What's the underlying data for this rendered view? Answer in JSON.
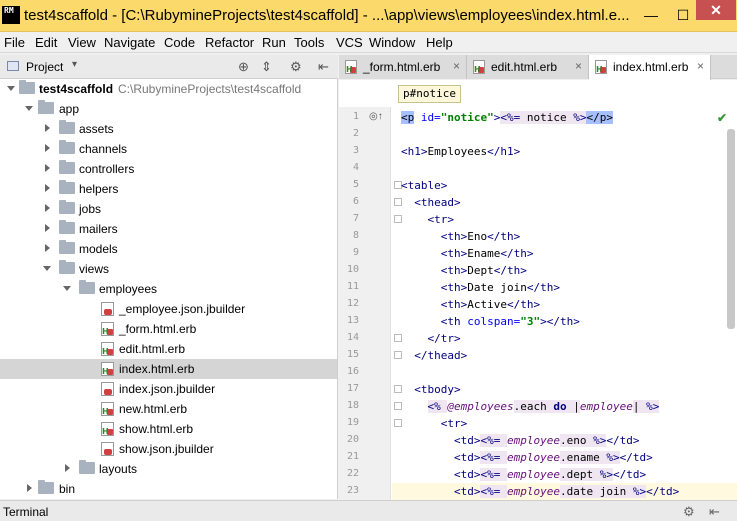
{
  "window": {
    "title": "test4scaffold - [C:\\RubymineProjects\\test4scaffold] - ...\\app\\views\\employees\\index.html.e...",
    "app_icon": "RM",
    "minimize": "—",
    "maximize": "☐",
    "close": "✕"
  },
  "menu": [
    "File",
    "Edit",
    "View",
    "Navigate",
    "Code",
    "Refactor",
    "Run",
    "Tools",
    "VCS",
    "Window",
    "Help"
  ],
  "project_pane": {
    "label": "Project",
    "dropdown": "▾",
    "icons": [
      "globe-icon",
      "collapse-icon",
      "gear-icon",
      "hide-icon"
    ]
  },
  "tree": [
    {
      "label": "test4scaffold",
      "path": "C:\\RubymineProjects\\test4scaffold",
      "type": "folder",
      "level": 0,
      "expanded": true,
      "bold": true
    },
    {
      "label": "app",
      "type": "folder",
      "level": 1,
      "expanded": true
    },
    {
      "label": "assets",
      "type": "folder",
      "level": 2,
      "expanded": false
    },
    {
      "label": "channels",
      "type": "folder",
      "level": 2,
      "expanded": false
    },
    {
      "label": "controllers",
      "type": "folder",
      "level": 2,
      "expanded": false
    },
    {
      "label": "helpers",
      "type": "folder",
      "level": 2,
      "expanded": false
    },
    {
      "label": "jobs",
      "type": "folder",
      "level": 2,
      "expanded": false
    },
    {
      "label": "mailers",
      "type": "folder",
      "level": 2,
      "expanded": false
    },
    {
      "label": "models",
      "type": "folder",
      "level": 2,
      "expanded": false
    },
    {
      "label": "views",
      "type": "folder",
      "level": 2,
      "expanded": true
    },
    {
      "label": "employees",
      "type": "folder",
      "level": 3,
      "expanded": true
    },
    {
      "label": "_employee.json.jbuilder",
      "type": "jb",
      "level": 4
    },
    {
      "label": "_form.html.erb",
      "type": "erb",
      "level": 4
    },
    {
      "label": "edit.html.erb",
      "type": "erb",
      "level": 4
    },
    {
      "label": "index.html.erb",
      "type": "erb",
      "level": 4,
      "selected": true
    },
    {
      "label": "index.json.jbuilder",
      "type": "jb",
      "level": 4
    },
    {
      "label": "new.html.erb",
      "type": "erb",
      "level": 4
    },
    {
      "label": "show.html.erb",
      "type": "erb",
      "level": 4
    },
    {
      "label": "show.json.jbuilder",
      "type": "jb",
      "level": 4
    },
    {
      "label": "layouts",
      "type": "folder",
      "level": 3,
      "expanded": false
    },
    {
      "label": "bin",
      "type": "folder",
      "level": 1,
      "expanded": false
    }
  ],
  "tabs": [
    {
      "label": "_form.html.erb",
      "active": false
    },
    {
      "label": "edit.html.erb",
      "active": false
    },
    {
      "label": "index.html.erb",
      "active": true
    }
  ],
  "tab_close": "×",
  "breadcrumb": "p#notice",
  "editor": {
    "check_mark": "✔",
    "gutter_marker": "◎↑",
    "lines": [
      {
        "n": 1,
        "html": "<span class='sel'>&lt;p</span> <span class='attr'>id=</span><span class='str'>\"notice\"</span><span class='tag'>&gt;</span><span class='erbtag'>&lt;%=</span><span class='ruby'> notice </span><span class='erbtag'>%&gt;</span><span class='sel'>&lt;/p&gt;</span>"
      },
      {
        "n": 2,
        "html": ""
      },
      {
        "n": 3,
        "html": "<span class='tag'>&lt;h1&gt;</span>Employees<span class='tag'>&lt;/h1&gt;</span>"
      },
      {
        "n": 4,
        "html": ""
      },
      {
        "n": 5,
        "html": "<span class='tag'>&lt;table&gt;</span>"
      },
      {
        "n": 6,
        "html": "  <span class='tag'>&lt;thead&gt;</span>"
      },
      {
        "n": 7,
        "html": "    <span class='tag'>&lt;tr&gt;</span>"
      },
      {
        "n": 8,
        "html": "      <span class='tag'>&lt;th&gt;</span>Eno<span class='tag'>&lt;/th&gt;</span>"
      },
      {
        "n": 9,
        "html": "      <span class='tag'>&lt;th&gt;</span>Ename<span class='tag'>&lt;/th&gt;</span>"
      },
      {
        "n": 10,
        "html": "      <span class='tag'>&lt;th&gt;</span>Dept<span class='tag'>&lt;/th&gt;</span>"
      },
      {
        "n": 11,
        "html": "      <span class='tag'>&lt;th&gt;</span>Date join<span class='tag'>&lt;/th&gt;</span>"
      },
      {
        "n": 12,
        "html": "      <span class='tag'>&lt;th&gt;</span>Active<span class='tag'>&lt;/th&gt;</span>"
      },
      {
        "n": 13,
        "html": "      <span class='tag'>&lt;th</span> <span class='attr'>colspan=</span><span class='str'>\"3\"</span><span class='tag'>&gt;&lt;/th&gt;</span>"
      },
      {
        "n": 14,
        "html": "    <span class='tag'>&lt;/tr&gt;</span>"
      },
      {
        "n": 15,
        "html": "  <span class='tag'>&lt;/thead&gt;</span>"
      },
      {
        "n": 16,
        "html": ""
      },
      {
        "n": 17,
        "html": "  <span class='tag'>&lt;tbody&gt;</span>"
      },
      {
        "n": 18,
        "html": "    <span class='erbtag'>&lt;%</span><span class='ruby'> </span><span class='rubyvar'>@employees</span><span class='ruby'>.each </span><span class='kw'>do</span><span class='ruby'> |</span><span class='rubyvar'>employee</span><span class='ruby'>| </span><span class='erbtag'>%&gt;</span>"
      },
      {
        "n": 19,
        "html": "      <span class='tag'>&lt;tr&gt;</span>"
      },
      {
        "n": 20,
        "html": "        <span class='tag'>&lt;td&gt;</span><span class='erbtag'>&lt;%=</span><span class='ruby'> </span><span class='rubyvar'>employee</span><span class='ruby'>.eno </span><span class='erbtag'>%&gt;</span><span class='tag'>&lt;/td&gt;</span>"
      },
      {
        "n": 21,
        "html": "        <span class='tag'>&lt;td&gt;</span><span class='erbtag'>&lt;%=</span><span class='ruby'> </span><span class='rubyvar'>employee</span><span class='ruby'>.ename </span><span class='erbtag'>%&gt;</span><span class='tag'>&lt;/td&gt;</span>"
      },
      {
        "n": 22,
        "html": "        <span class='tag'>&lt;td&gt;</span><span class='erbtag'>&lt;%=</span><span class='ruby'> </span><span class='rubyvar'>employee</span><span class='ruby'>.dept </span><span class='erbtag'>%&gt;</span><span class='tag'>&lt;/td&gt;</span>"
      },
      {
        "n": 23,
        "html": "        <span class='tag'>&lt;td&gt;</span><span class='erbtag'>&lt;%=</span><span class='ruby'> </span><span class='rubyvar'>employee</span><span class='ruby'>.date join </span><span class='erbtag'>%&gt;</span><span class='tag'>&lt;/td&gt;</span>"
      }
    ]
  },
  "bottom": {
    "terminal_label": "Terminal"
  }
}
